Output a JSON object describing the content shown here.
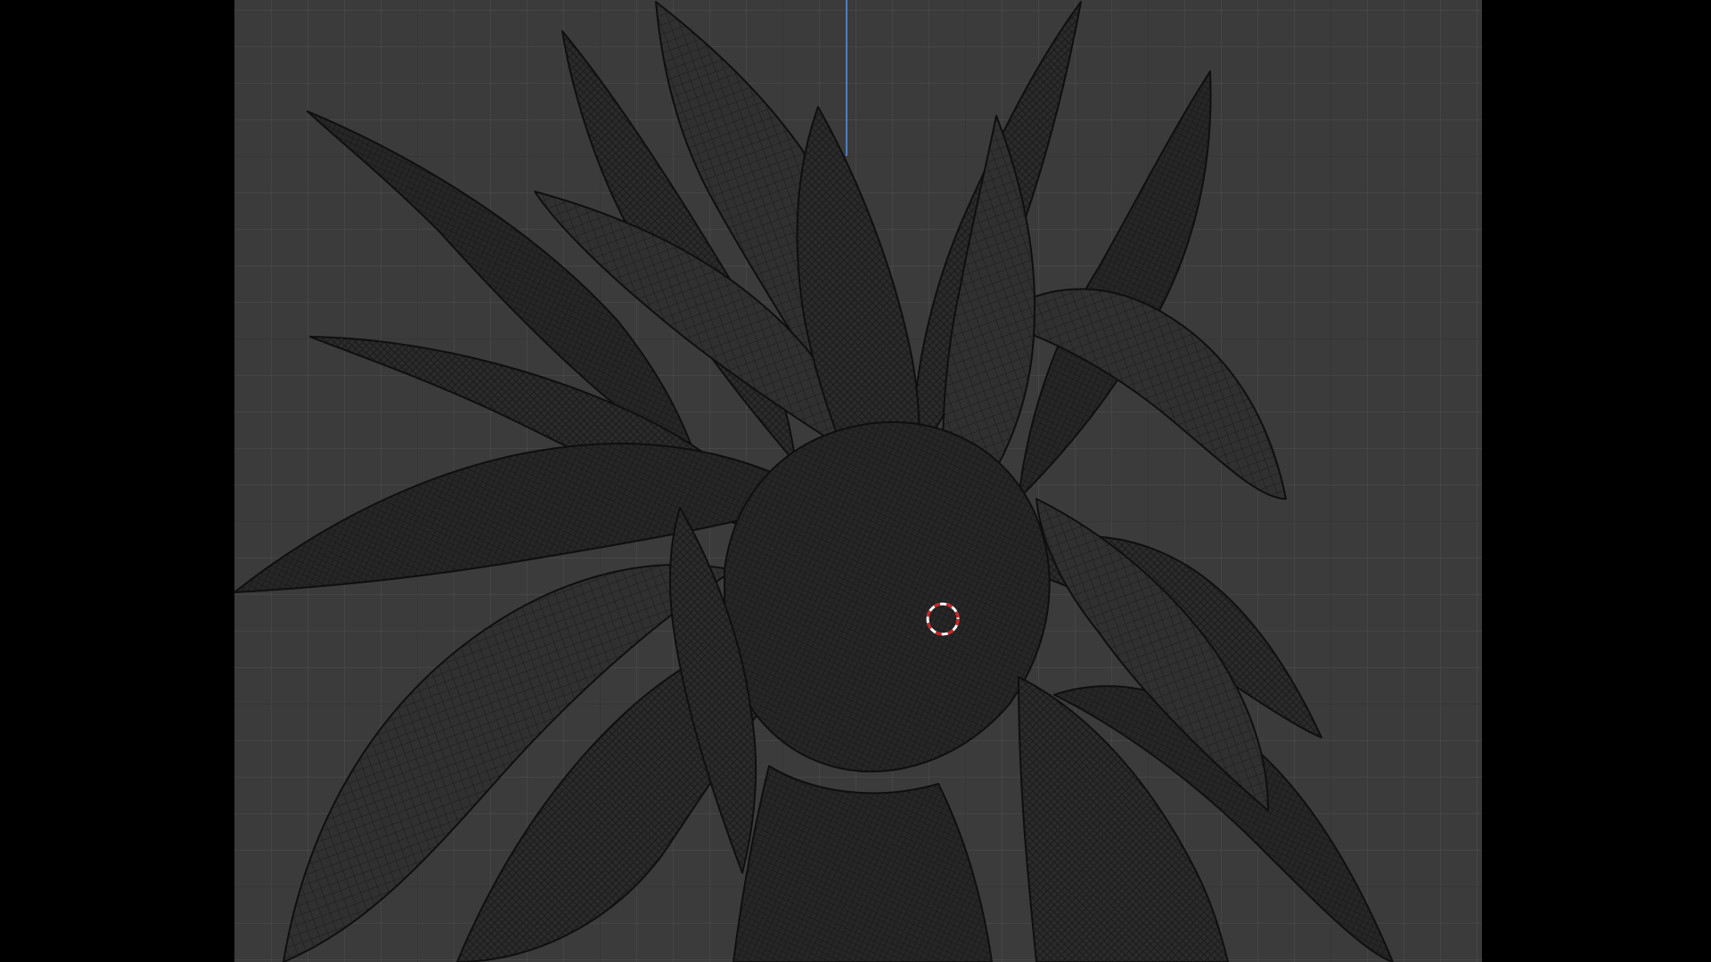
{
  "app": {
    "view": "3d-viewport",
    "mode": "wireframe"
  },
  "colors": {
    "background": "#3b3b3b",
    "grid_major": "#2f2f2f",
    "grid_minor": "#434343",
    "mesh_fill": "#2a2a2a",
    "mesh_wire": "#151515",
    "z_axis": "#4f7fbf",
    "cursor_red": "#cc2222",
    "cursor_white": "#ffffff"
  },
  "icons": {
    "cursor": "3d-cursor-icon",
    "axis": "z-axis-line"
  }
}
